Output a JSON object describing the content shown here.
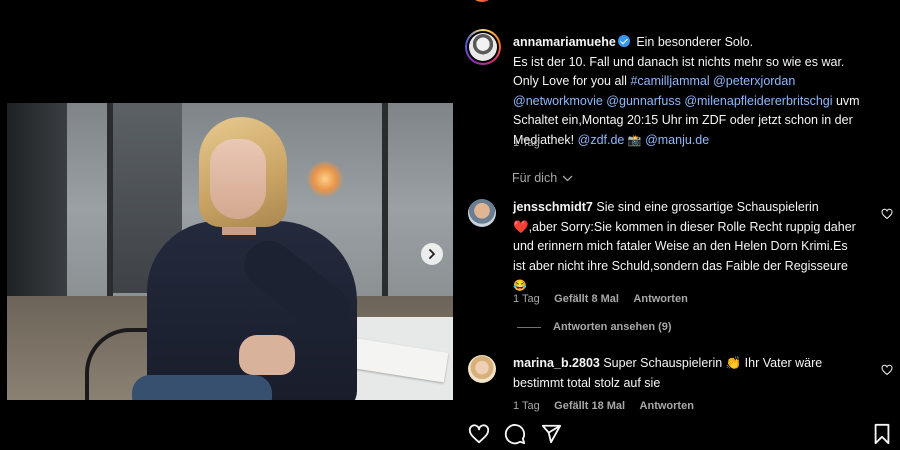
{
  "post": {
    "author": "annamariamuehe",
    "caption_lines": [
      "Ein besonderer Solo.",
      "Es ist der 10. Fall und danach ist nichts mehr so wie es war.",
      "Only Love for you all"
    ],
    "tags_line1": [
      "#camilljammal",
      "@peterxjordan"
    ],
    "tags_line2": [
      "@networkmovie",
      "@gunnarfuss",
      "@milenapfleidererbritschgi"
    ],
    "tags_line2_trail": "uvm",
    "caption_line4": "Schaltet ein,Montag 20:15 Uhr im ZDF oder jetzt schon in der",
    "caption_line5_text": "Mediathek!",
    "caption_line5_tags": [
      "@zdf.de",
      "@manju.de"
    ],
    "caption_line5_emoji": "📸",
    "time": "1 Tag",
    "for_you": "Für dich"
  },
  "comments": [
    {
      "username": "jensschmidt7",
      "text_line1": "Sie sind eine grossartige Schauspielerin",
      "text_line2": "❤️,aber Sorry:Sie kommen in dieser Rolle Recht ruppig daher",
      "text_line3": "und erinnern mich fataler Weise an den Helen Dorn Krimi.Es",
      "text_line4": "ist aber nicht ihre Schuld,sondern das Faible der Regisseure",
      "emoji": "😂",
      "time": "1 Tag",
      "likes": "Gefällt 8 Mal",
      "reply": "Antworten",
      "view_replies": "Antworten ansehen (9)"
    },
    {
      "username": "marina_b.2803",
      "text_line1": "Super Schauspielerin 👏 Ihr Vater wäre",
      "text_line2": "bestimmt total stolz auf sie",
      "time": "1 Tag",
      "likes": "Gefällt 18 Mal",
      "reply": "Antworten"
    }
  ],
  "icons": {
    "next": "chevron-right-icon",
    "like": "heart-icon",
    "comment": "comment-icon",
    "share": "share-icon",
    "save": "bookmark-icon"
  },
  "colors": {
    "background": "#000000",
    "text": "#f5f5f5",
    "secondary": "#a8a8a8",
    "link": "#8fb8ff",
    "verified": "#3897f0"
  }
}
